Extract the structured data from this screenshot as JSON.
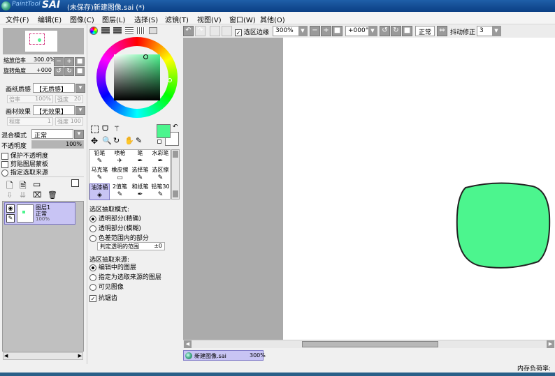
{
  "app": {
    "logo_brand": "PaintTool",
    "logo_name": "SAI",
    "title": "(未保存)新建图像.sai (*)"
  },
  "menu": [
    "文件(F)",
    "编辑(E)",
    "图像(C)",
    "图层(L)",
    "选择(S)",
    "滤镜(T)",
    "视图(V)",
    "窗口(W)",
    "其他(O)"
  ],
  "toolbar": {
    "selection_edge_label": "选区边缘",
    "selection_edge_checked": true,
    "zoom": "300%",
    "rotation": "+000°",
    "mode": "正常",
    "stabilizer_label": "抖动修正",
    "stabilizer_value": "3"
  },
  "navigator": {
    "zoom_label": "缩放倍率",
    "zoom_value": "300.0%",
    "rotate_label": "旋转角度",
    "rotate_value": "+000"
  },
  "paper": {
    "texture_label": "画纸质感",
    "texture_value": "【无质感】",
    "scale_label": "倍率",
    "scale_value": "100%",
    "strength_label": "强度",
    "strength_value": "20",
    "effect_label": "画材效果",
    "effect_value": "【无效果】",
    "degree_label": "程度",
    "degree_value": "1",
    "strength2_label": "强度",
    "strength2_value": "100"
  },
  "layer_props": {
    "blend_label": "混合模式",
    "blend_value": "正常",
    "opacity_label": "不透明度",
    "opacity_value": "100%",
    "opacity_fraction": 1.0,
    "options": [
      {
        "label": "保护不透明度",
        "checked": false
      },
      {
        "label": "剪贴图层蒙板",
        "checked": false
      }
    ],
    "source_label": "指定选取来源"
  },
  "layers": [
    {
      "name": "图层1",
      "mode": "正常",
      "opacity": "100%"
    }
  ],
  "color": {
    "primary": "#4cf58e",
    "secondary": "#ffffff"
  },
  "tools": [
    {
      "label": "铅笔",
      "icon": "✎"
    },
    {
      "label": "喷枪",
      "icon": "✈"
    },
    {
      "label": "笔",
      "icon": "✒"
    },
    {
      "label": "水彩笔",
      "icon": "✒"
    },
    {
      "label": "马克笔",
      "icon": "✎"
    },
    {
      "label": "橡皮擦",
      "icon": "▭"
    },
    {
      "label": "选择笔",
      "icon": "✎"
    },
    {
      "label": "选区擦",
      "icon": "✎"
    },
    {
      "label": "油漆桶",
      "icon": "◈"
    },
    {
      "label": "2值笔",
      "icon": "✎"
    },
    {
      "label": "和纸笔",
      "icon": "✒"
    },
    {
      "label": "铅笔30",
      "icon": "✎"
    }
  ],
  "bucket": {
    "mode_title": "选区抽取模式:",
    "modes": [
      {
        "label": "透明部分(精确)",
        "selected": true
      },
      {
        "label": "透明部分(模糊)",
        "selected": false
      },
      {
        "label": "色差范围内的部分",
        "selected": false
      }
    ],
    "range_label": "判定透明的范围",
    "range_value": "±0",
    "source_title": "选区抽取来源:",
    "sources": [
      {
        "label": "编辑中的图层",
        "selected": true
      },
      {
        "label": "指定为选取来源的图层",
        "selected": false
      },
      {
        "label": "可见图像",
        "selected": false
      }
    ],
    "antialias_label": "抗锯齿",
    "antialias_checked": true
  },
  "file_tab": {
    "name": "新建图像.sai",
    "zoom": "300%"
  },
  "status": {
    "memory_label": "内存负荷率:"
  }
}
